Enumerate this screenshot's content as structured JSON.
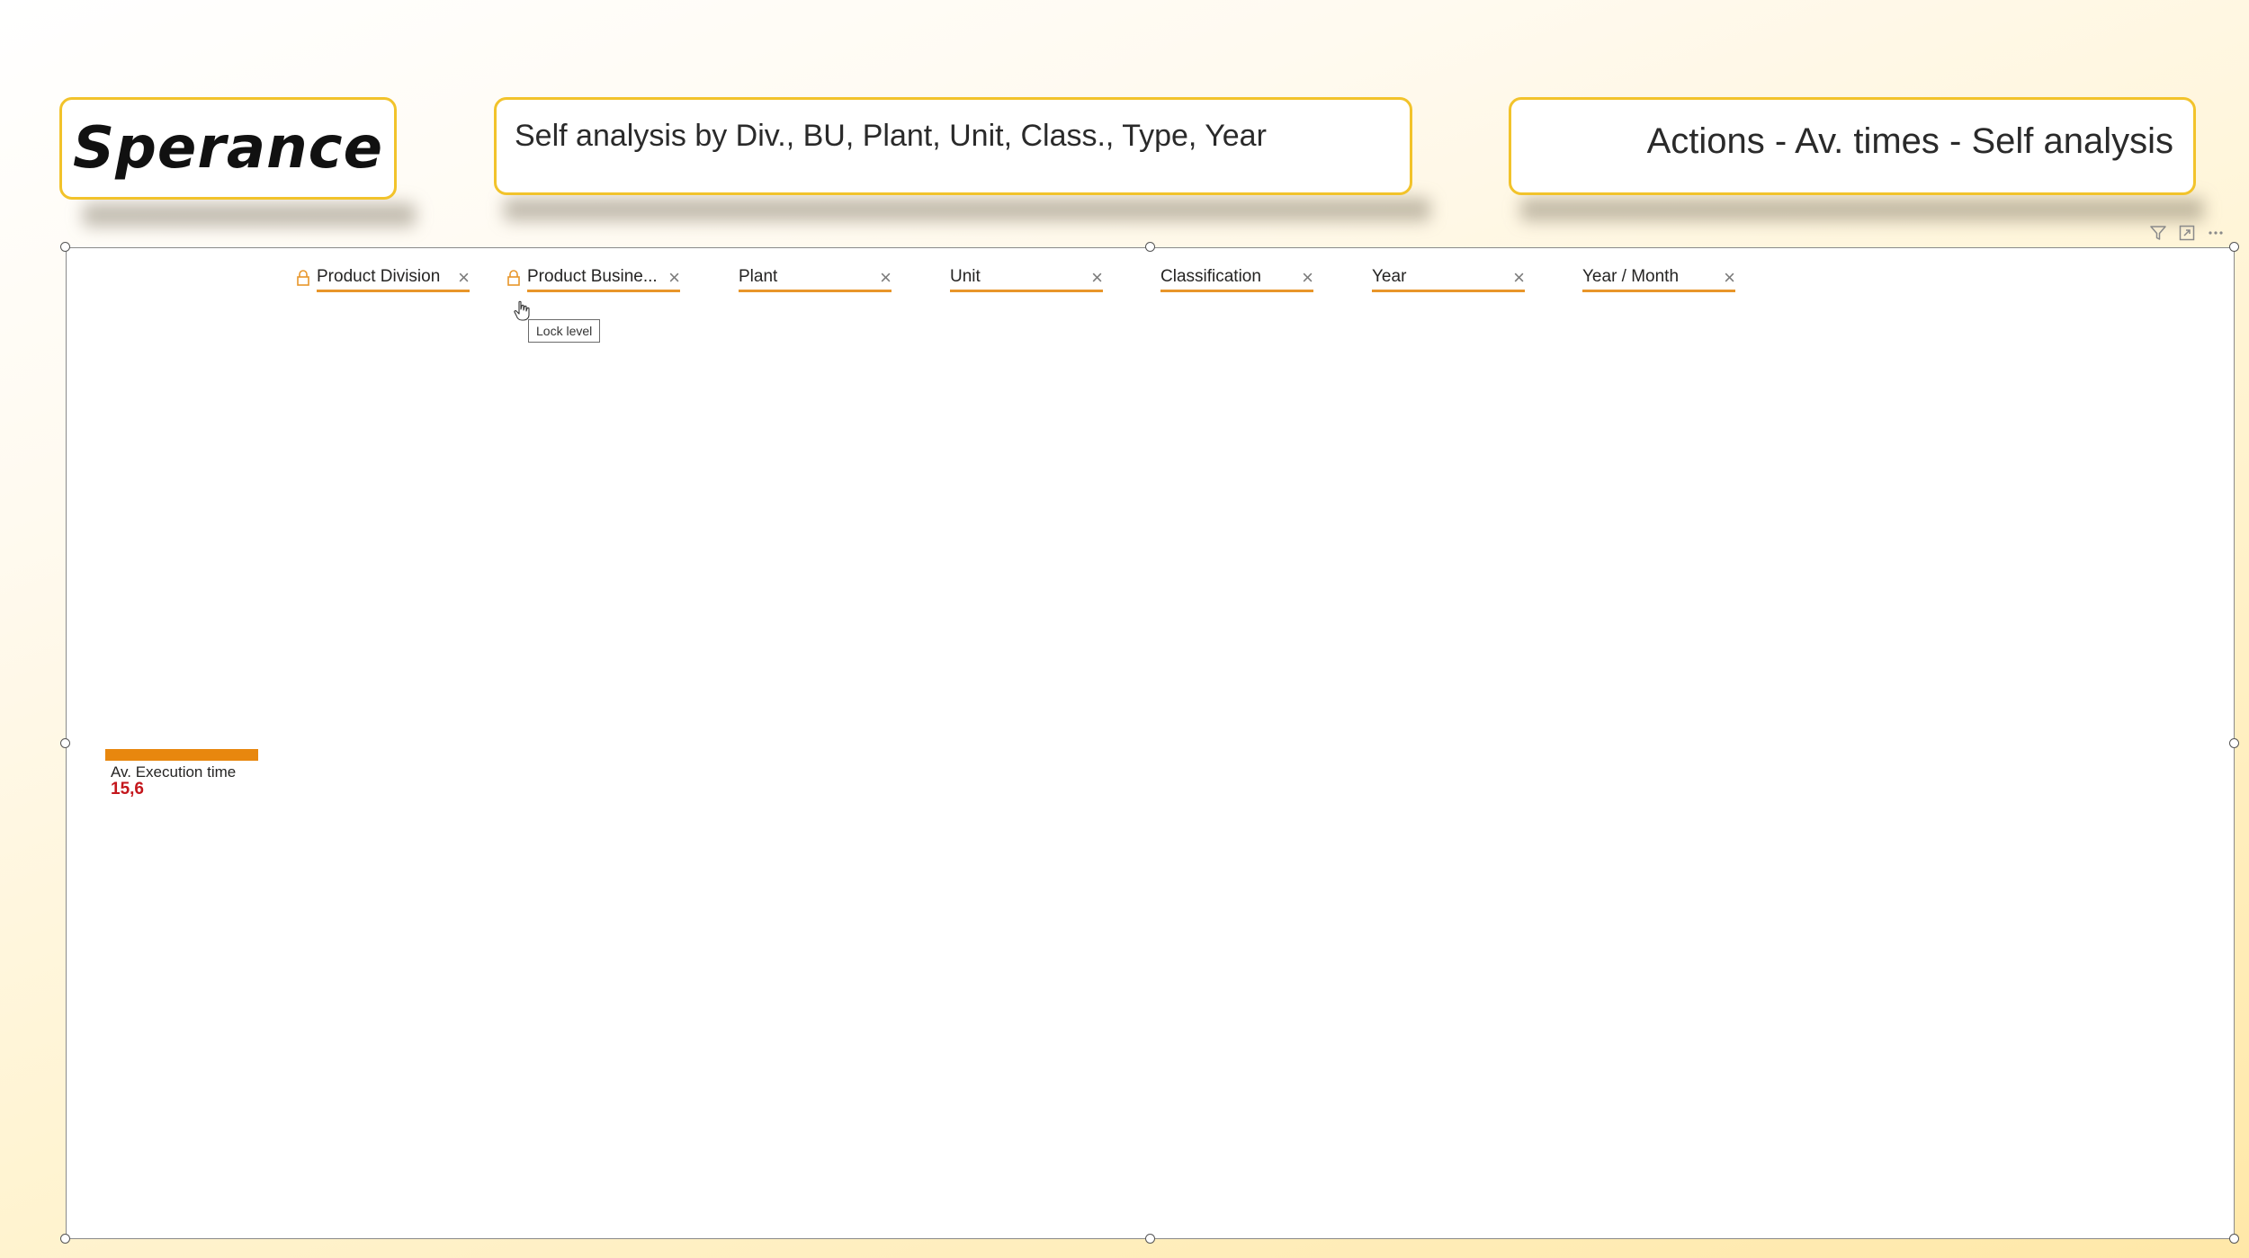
{
  "header": {
    "brand": "Sperance",
    "subtitle": "Self analysis by Div., BU, Plant, Unit, Class., Type, Year",
    "title": "Actions - Av. times - Self analysis"
  },
  "visual": {
    "tool_icons": [
      "filter-icon",
      "focus-mode-icon",
      "more-options-icon"
    ],
    "filters": [
      {
        "label": "Product Division",
        "locked": true
      },
      {
        "label": "Product Busine...",
        "locked": true
      },
      {
        "label": "Plant",
        "locked": false
      },
      {
        "label": "Unit",
        "locked": false
      },
      {
        "label": "Classification",
        "locked": false
      },
      {
        "label": "Year",
        "locked": false
      },
      {
        "label": "Year / Month",
        "locked": false
      }
    ],
    "close_glyph": "×",
    "tooltip": "Lock level",
    "root_node": {
      "label": "Av. Execution time",
      "value": "15,6"
    }
  },
  "colors": {
    "accent": "#e8962a",
    "card_border": "#f2c32b",
    "value_red": "#c4161c",
    "bar_orange": "#e8870e"
  }
}
